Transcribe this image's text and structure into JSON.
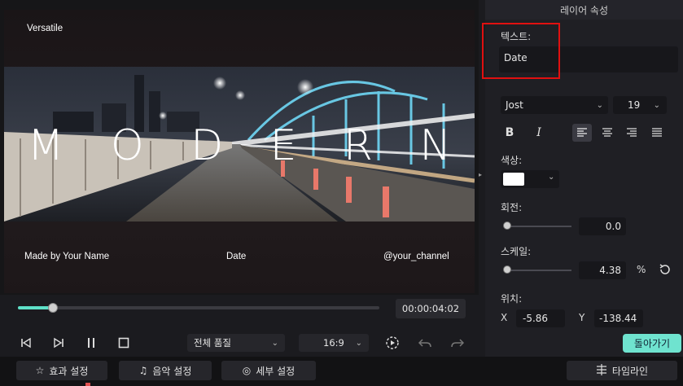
{
  "preview": {
    "title_text": "Versatile",
    "big_text": [
      "M",
      "O",
      "D",
      "E",
      "R",
      "N"
    ],
    "footer_left": "Made by Your Name",
    "footer_center": "Date",
    "footer_right": "@your_channel"
  },
  "playback": {
    "timecode": "00:00:04:02",
    "progress": 0.095,
    "quality_label": "전체 품질",
    "ratio_label": "16:9"
  },
  "panel": {
    "title": "레이어 속성",
    "text_label": "텍스트:",
    "text_value": "Date",
    "font": "Jost",
    "font_size": "19",
    "bold": "B",
    "italic": "I",
    "color_label": "색상:",
    "color_value": "#ffffff",
    "rotation_label": "회전:",
    "rotation_value": "0.0",
    "scale_label": "스케일:",
    "scale_value": "4.38",
    "scale_unit": "%",
    "position_label": "위치:",
    "x_label": "X",
    "x_value": "-5.86",
    "y_label": "Y",
    "y_value": "-138.44",
    "back_button": "돌아가기"
  },
  "bottom": {
    "effects": "효과 설정",
    "music": "음악 설정",
    "details": "세부 설정",
    "timeline": "타임라인"
  },
  "colors": {
    "accent": "#5ee0c8",
    "highlight": "#e01010"
  }
}
